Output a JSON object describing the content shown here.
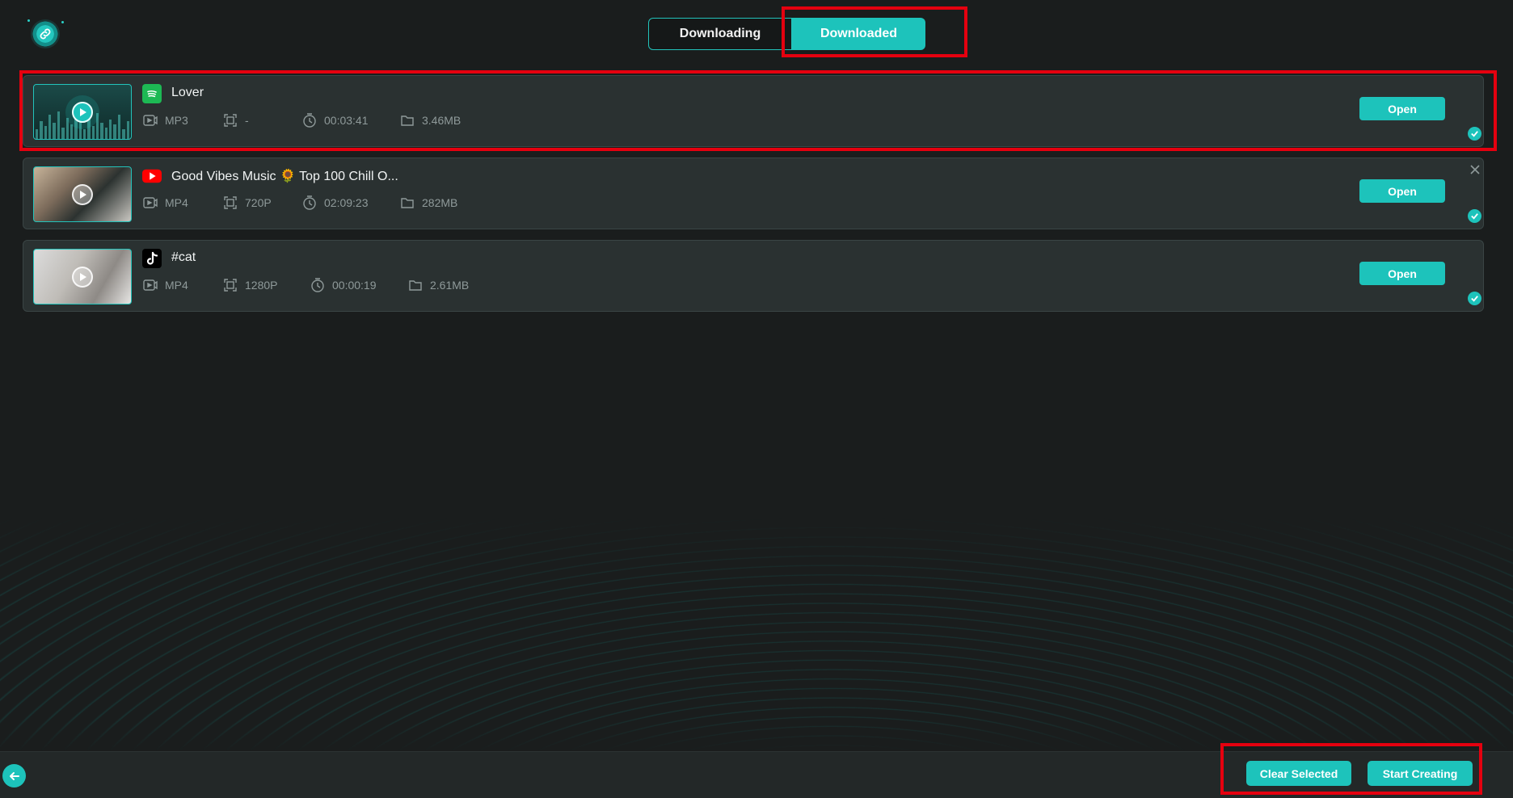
{
  "tabs": {
    "downloading": "Downloading",
    "downloaded": "Downloaded",
    "active": "downloaded"
  },
  "items": [
    {
      "source": "spotify",
      "source_icon": "spotify-icon",
      "title": "Lover",
      "format": "MP3",
      "resolution": "-",
      "duration": "00:03:41",
      "size": "3.46MB",
      "open_label": "Open",
      "selected": true
    },
    {
      "source": "youtube",
      "source_icon": "youtube-icon",
      "title": "Good Vibes Music 🌻 Top 100 Chill O...",
      "format": "MP4",
      "resolution": "720P",
      "duration": "02:09:23",
      "size": "282MB",
      "open_label": "Open",
      "selected": true
    },
    {
      "source": "tiktok",
      "source_icon": "tiktok-icon",
      "title": "#cat",
      "format": "MP4",
      "resolution": "1280P",
      "duration": "00:00:19",
      "size": "2.61MB",
      "open_label": "Open",
      "selected": true
    }
  ],
  "footer": {
    "clear_label": "Clear Selected",
    "start_label": "Start Creating"
  },
  "colors": {
    "accent": "#1dc3bb",
    "background": "#1a1d1d",
    "item_bg": "#2a3131",
    "highlight": "#e5000f"
  }
}
